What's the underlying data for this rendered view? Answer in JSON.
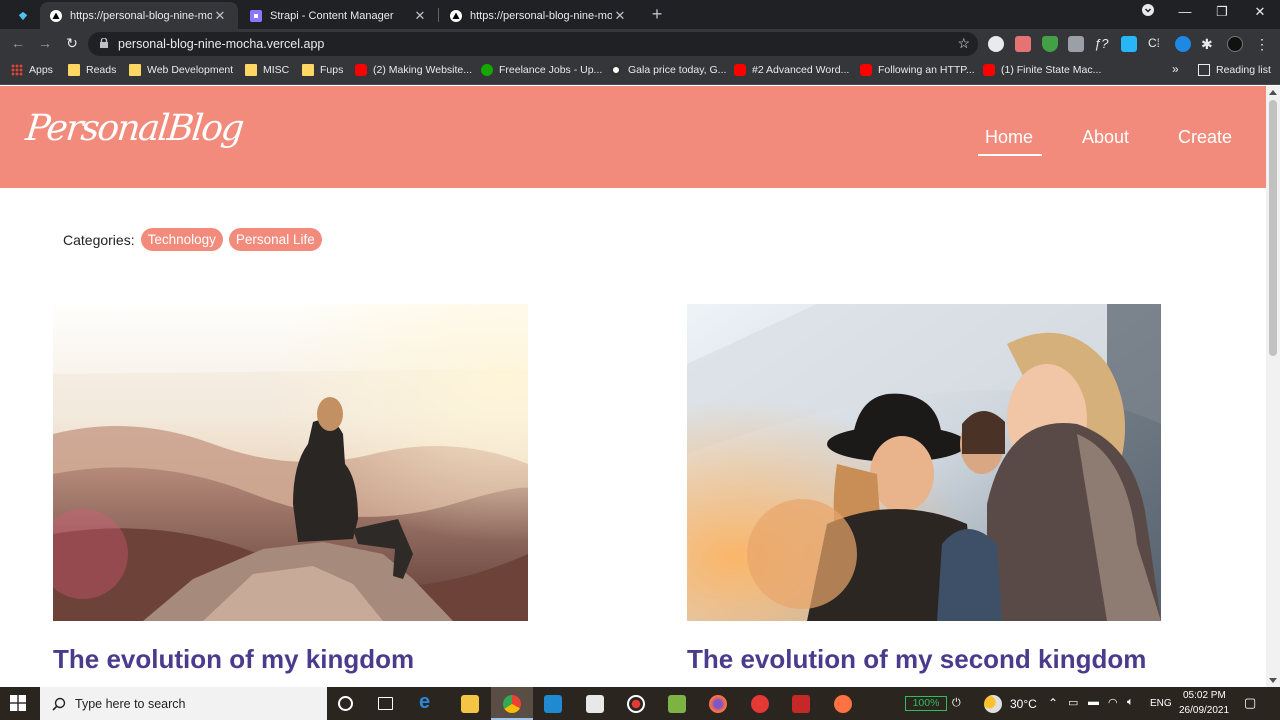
{
  "browser": {
    "tabs": [
      {
        "title": "https://personal-blog-nine-mocha.vercel.app",
        "active": true
      },
      {
        "title": "Strapi - Content Manager",
        "active": false
      },
      {
        "title": "https://personal-blog-nine-mocha.vercel.app",
        "active": false
      }
    ],
    "url": "personal-blog-nine-mocha.vercel.app",
    "bookmarks": [
      {
        "label": "Apps",
        "icon": "apps-grid-icon"
      },
      {
        "label": "Reads",
        "icon": "folder-icon"
      },
      {
        "label": "Web Development",
        "icon": "folder-icon"
      },
      {
        "label": "MISC",
        "icon": "folder-icon"
      },
      {
        "label": "Fups",
        "icon": "folder-icon"
      },
      {
        "label": "(2) Making Website...",
        "icon": "youtube-icon"
      },
      {
        "label": "Freelance Jobs - Up...",
        "icon": "upwork-icon"
      },
      {
        "label": "Gala price today, G...",
        "icon": "gala-icon"
      },
      {
        "label": "#2 Advanced Word...",
        "icon": "youtube-icon"
      },
      {
        "label": "Following an HTTP...",
        "icon": "youtube-icon"
      },
      {
        "label": "(1) Finite State Mac...",
        "icon": "youtube-icon"
      }
    ],
    "more_bookmarks": "»",
    "reading_list": "Reading list"
  },
  "site": {
    "logo": "PersonalBlog",
    "nav": [
      {
        "label": "Home",
        "active": true
      },
      {
        "label": "About",
        "active": false
      },
      {
        "label": "Create",
        "active": false
      }
    ],
    "categories_label": "Categories:",
    "categories": [
      "Technology",
      "Personal Life"
    ],
    "posts": [
      {
        "title": "The evolution of my kingdom"
      },
      {
        "title": "The evolution of my second kingdom"
      }
    ]
  },
  "taskbar": {
    "search_placeholder": "Type here to search",
    "battery": "100%",
    "weather": "30°C",
    "language": "ENG",
    "time": "05:02 PM",
    "date": "26/09/2021"
  },
  "colors": {
    "header": "#f28b7b",
    "title": "#4a3b8c"
  }
}
